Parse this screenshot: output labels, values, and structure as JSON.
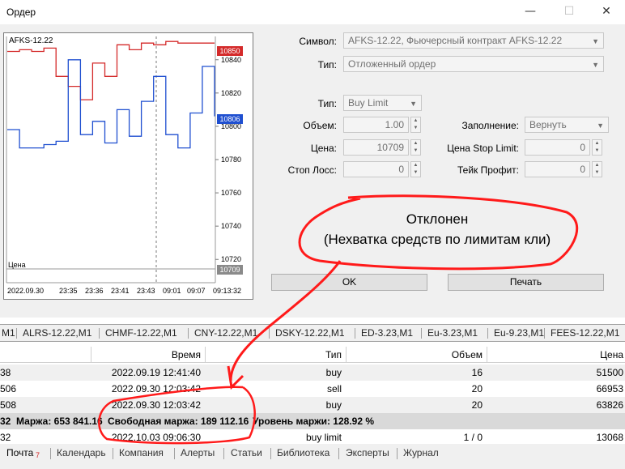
{
  "window": {
    "title": "Ордер"
  },
  "chart": {
    "symbol": "AFKS-12.22",
    "y_ticks": [
      "10840",
      "10820",
      "10800",
      "10780",
      "10760",
      "10740",
      "10720"
    ],
    "badges": {
      "top": "10850",
      "mid": "10806",
      "bottom": "10709"
    },
    "price_label": "Цена",
    "x_ticks": [
      "2022.09.30",
      "23:35",
      "23:36",
      "23:41",
      "23:43",
      "09:01",
      "09:07",
      "09:13:32"
    ]
  },
  "chart_data": {
    "type": "line",
    "title": "AFKS-12.22",
    "x_labels": [
      "2022.09.30",
      "23:35",
      "23:36",
      "23:41",
      "23:43",
      "09:01",
      "09:07",
      "09:13:32"
    ],
    "ylim": [
      10706,
      10854
    ],
    "series": [
      {
        "name": "ask",
        "color": "#d42a2a",
        "values": [
          10845,
          10846,
          10845,
          10847,
          10830,
          10824,
          10816,
          10838,
          10830,
          10849,
          10846,
          10850,
          10849,
          10851,
          10850,
          10850,
          10850,
          10850
        ]
      },
      {
        "name": "bid",
        "color": "#1f4fd0",
        "values": [
          10798,
          10787,
          10787,
          10789,
          10791,
          10840,
          10795,
          10803,
          10790,
          10810,
          10794,
          10815,
          10830,
          10795,
          10787,
          10808,
          10836,
          10806
        ]
      }
    ]
  },
  "form": {
    "symbol_label": "Символ:",
    "symbol_value": "AFKS-12.22, Фьючерсный контракт AFKS-12.22",
    "type_label": "Тип:",
    "type_value": "Отложенный ордер",
    "subtype_label": "Тип:",
    "subtype_value": "Buy Limit",
    "volume_label": "Объем:",
    "volume_value": "1.00",
    "price_label": "Цена:",
    "price_value": "10709",
    "sl_label": "Стоп Лосс:",
    "sl_value": "0",
    "fill_label": "Заполнение:",
    "fill_value": "Вернуть",
    "stoplimit_label": "Цена Stop Limit:",
    "stoplimit_value": "0",
    "tp_label": "Тейк Профит:",
    "tp_value": "0",
    "ok_label": "OK",
    "print_label": "Печать"
  },
  "annotation": {
    "line1": "Отклонен",
    "line2": "(Нехватка средств по лимитам кли)"
  },
  "symbol_tabs": [
    "M1",
    "ALRS-12.22,M1",
    "CHMF-12.22,M1",
    "CNY-12.22,M1",
    "DSKY-12.22,M1",
    "ED-3.23,M1",
    "Eu-3.23,M1",
    "Eu-9.23,M1",
    "FEES-12.22,M1"
  ],
  "table": {
    "headers": {
      "time": "Время",
      "type": "Тип",
      "volume": "Объем",
      "price": "Цена"
    },
    "rows": [
      {
        "id": "38",
        "time": "2022.09.19 12:41:40",
        "type": "buy",
        "volume": "16",
        "price": "51500"
      },
      {
        "id": "506",
        "time": "2022.09.30 12:03:42",
        "type": "sell",
        "volume": "20",
        "price": "66953"
      },
      {
        "id": "508",
        "time": "2022.09.30 12:03:42",
        "type": "buy",
        "volume": "20",
        "price": "63826"
      }
    ],
    "summary": {
      "prefix": "32",
      "margin": "Маржа: 653 841.16",
      "free": "Свободная маржа: 189 112.16",
      "level": "Уровень маржи: 128.92 %"
    },
    "order": {
      "id": "32",
      "time": "2022.10.03 09:06:30",
      "type": "buy limit",
      "volume": "1 / 0",
      "price": "13068"
    }
  },
  "bottom_tabs": {
    "mail": "Почта",
    "mail_badge": "7",
    "calendar": "Календарь",
    "company": "Компания",
    "alerts": "Алерты",
    "articles": "Статьи",
    "library": "Библиотека",
    "experts": "Эксперты",
    "journal": "Журнал"
  }
}
